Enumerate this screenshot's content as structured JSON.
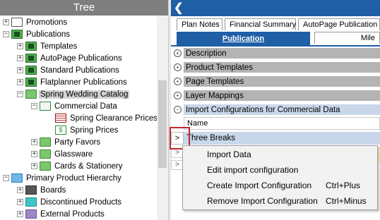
{
  "tree": {
    "title": "Tree",
    "nodes": [
      {
        "label": "Promotions"
      },
      {
        "label": "Publications"
      },
      {
        "label": "Templates"
      },
      {
        "label": "AutoPage Publications"
      },
      {
        "label": "Standard Publications"
      },
      {
        "label": "Flatplanner Publications"
      },
      {
        "label": "Spring Wedding Catalog"
      },
      {
        "label": "Commercial Data"
      },
      {
        "label": "Spring Clearance Prices"
      },
      {
        "label": "Spring Prices"
      },
      {
        "label": "Party Favors"
      },
      {
        "label": "Glassware"
      },
      {
        "label": "Cards & Stationery"
      },
      {
        "label": "Primary Product Hierarchy"
      },
      {
        "label": "Boards"
      },
      {
        "label": "Discontinued Products"
      },
      {
        "label": "External Products"
      }
    ]
  },
  "tabs": {
    "plan_notes": "Plan Notes",
    "financial_summary": "Financial Summary",
    "autopage": "AutoPage Publication I",
    "publication": "Publication",
    "mile": "Mile"
  },
  "sections": {
    "description": "Description",
    "product_templates": "Product Templates",
    "page_templates": "Page Templates",
    "layer_mappings": "Layer Mappings",
    "import_configs": "Import Configurations for Commercial Data"
  },
  "grid": {
    "column_name": "Name",
    "row_label": "Three Breaks"
  },
  "context_menu": {
    "items": [
      {
        "label": "Import Data",
        "shortcut": ""
      },
      {
        "label": "Edit import configuration",
        "shortcut": ""
      },
      {
        "label": "Create Import Configuration",
        "shortcut": "Ctrl+Plus"
      },
      {
        "label": "Remove Import Configuration",
        "shortcut": "Ctrl+Minus"
      }
    ]
  },
  "colors": {
    "accent_blue": "#1f5fa6",
    "annotation_red": "#c0282f",
    "selected_row": "#c9d7ea",
    "section_bar": "#b4b4b4"
  }
}
